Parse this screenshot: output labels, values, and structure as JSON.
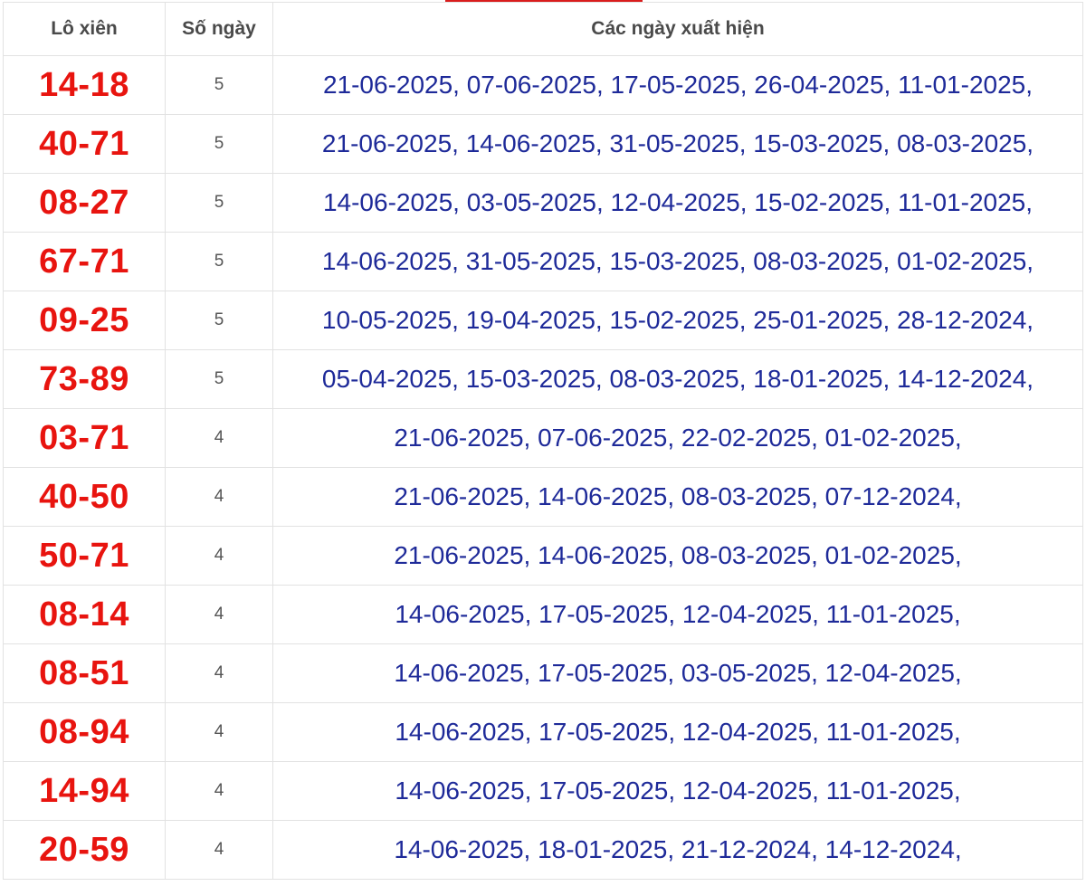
{
  "header": {
    "col_pair": "Lô xiên",
    "col_days": "Số ngày",
    "col_dates": "Các ngày xuất hiện"
  },
  "colors": {
    "pair": "#e8140f",
    "dates": "#1e2a99",
    "header_text": "#4a4a4a",
    "border": "#e2e2e2",
    "accent": "#d91c1c"
  },
  "rows": [
    {
      "pair": "14-18",
      "days": "5",
      "dates": "21-06-2025, 07-06-2025, 17-05-2025, 26-04-2025, 11-01-2025,"
    },
    {
      "pair": "40-71",
      "days": "5",
      "dates": "21-06-2025, 14-06-2025, 31-05-2025, 15-03-2025, 08-03-2025,"
    },
    {
      "pair": "08-27",
      "days": "5",
      "dates": "14-06-2025, 03-05-2025, 12-04-2025, 15-02-2025, 11-01-2025,"
    },
    {
      "pair": "67-71",
      "days": "5",
      "dates": "14-06-2025, 31-05-2025, 15-03-2025, 08-03-2025, 01-02-2025,"
    },
    {
      "pair": "09-25",
      "days": "5",
      "dates": "10-05-2025, 19-04-2025, 15-02-2025, 25-01-2025, 28-12-2024,"
    },
    {
      "pair": "73-89",
      "days": "5",
      "dates": "05-04-2025, 15-03-2025, 08-03-2025, 18-01-2025, 14-12-2024,"
    },
    {
      "pair": "03-71",
      "days": "4",
      "dates": "21-06-2025, 07-06-2025, 22-02-2025, 01-02-2025,"
    },
    {
      "pair": "40-50",
      "days": "4",
      "dates": "21-06-2025, 14-06-2025, 08-03-2025, 07-12-2024,"
    },
    {
      "pair": "50-71",
      "days": "4",
      "dates": "21-06-2025, 14-06-2025, 08-03-2025, 01-02-2025,"
    },
    {
      "pair": "08-14",
      "days": "4",
      "dates": "14-06-2025, 17-05-2025, 12-04-2025, 11-01-2025,"
    },
    {
      "pair": "08-51",
      "days": "4",
      "dates": "14-06-2025, 17-05-2025, 03-05-2025, 12-04-2025,"
    },
    {
      "pair": "08-94",
      "days": "4",
      "dates": "14-06-2025, 17-05-2025, 12-04-2025, 11-01-2025,"
    },
    {
      "pair": "14-94",
      "days": "4",
      "dates": "14-06-2025, 17-05-2025, 12-04-2025, 11-01-2025,"
    },
    {
      "pair": "20-59",
      "days": "4",
      "dates": "14-06-2025, 18-01-2025, 21-12-2024, 14-12-2024,"
    }
  ]
}
